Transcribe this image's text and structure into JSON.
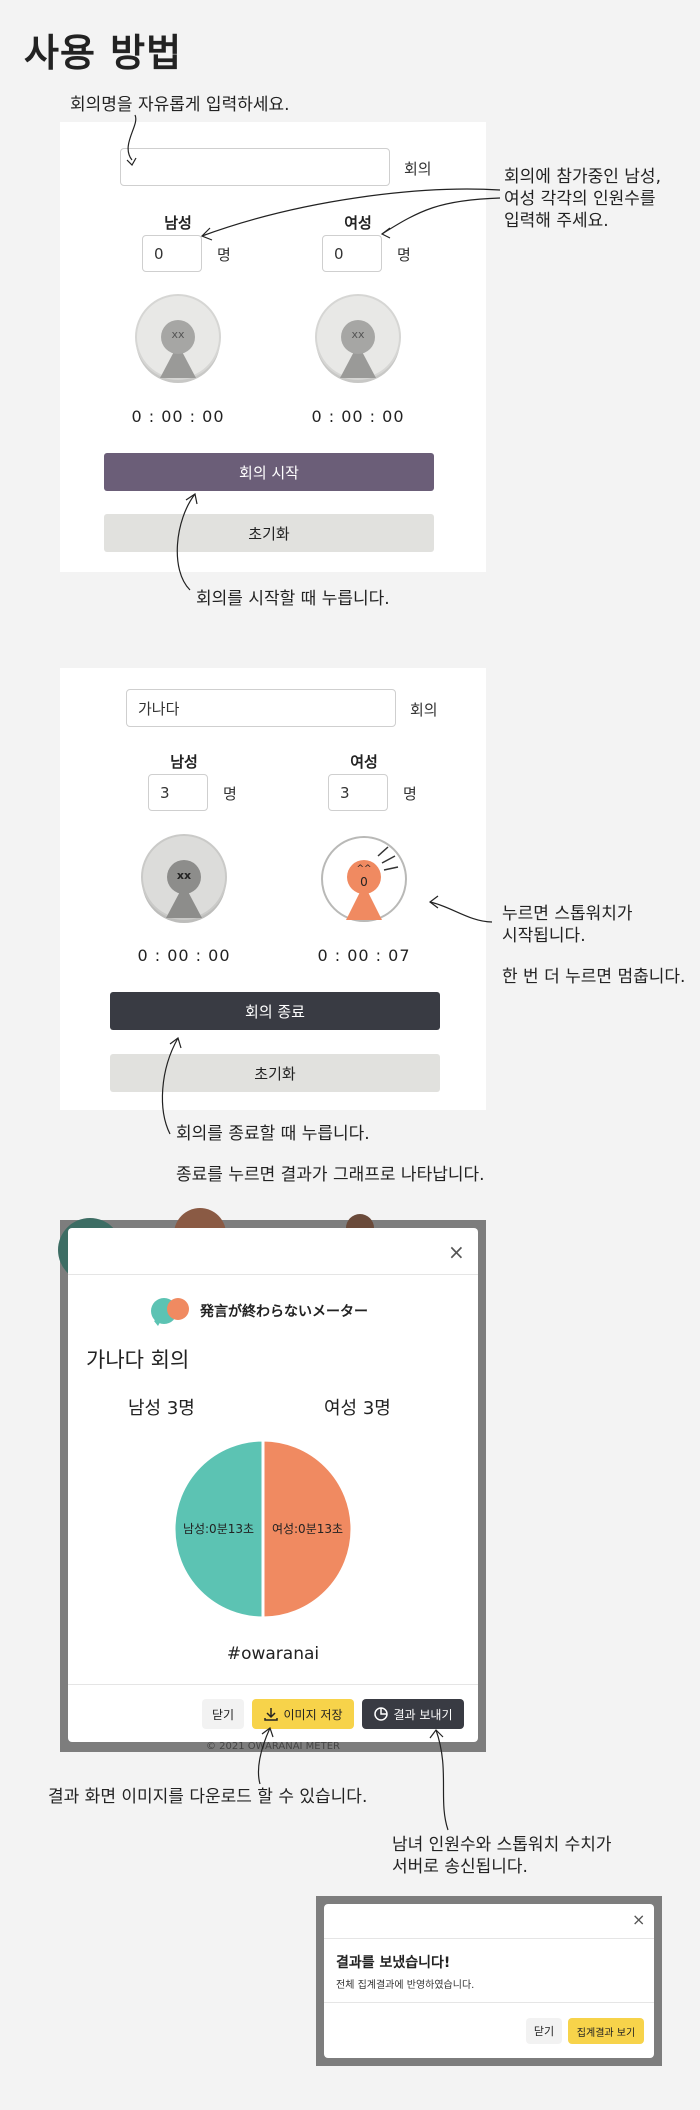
{
  "page": {
    "title": "사용 방법"
  },
  "notes": {
    "name_input": "회의명을 자유롭게 입력하세요.",
    "gender_counts": [
      "회의에 참가중인 남성,",
      "여성 각각의 인원수를",
      "입력해 주세요."
    ],
    "start": "회의를 시작할 때 누릅니다.",
    "stopwatch": [
      "누르면 스톱워치가",
      "시작됩니다."
    ],
    "stop_again": "한 번 더 누르면 멈춥니다.",
    "end": "회의를 종료할 때 누릅니다.",
    "graph": "종료를 누르면 결과가 그래프로 나타납니다.",
    "download": "결과 화면 이미지를 다운로드 할 수 있습니다.",
    "send": [
      "남녀 인원수와 스톱워치 수치가",
      "서버로 송신됩니다."
    ]
  },
  "panel1": {
    "meeting_name_value": "",
    "meeting_suffix": "회의",
    "male_label": "남성",
    "female_label": "여성",
    "male_count": "0",
    "female_count": "0",
    "unit": "명",
    "male_face": "xx",
    "female_face": "xx",
    "male_timer": "0 : 00 : 00",
    "female_timer": "0 : 00 : 00",
    "start_button": "회의 시작",
    "reset_button": "초기화"
  },
  "panel2": {
    "meeting_name_value": "가나다",
    "meeting_suffix": "회의",
    "male_label": "남성",
    "female_label": "여성",
    "male_count": "3",
    "female_count": "3",
    "unit": "명",
    "male_face": "xx",
    "female_face": "^^",
    "female_talk_count": "0",
    "male_timer": "0 : 00 : 00",
    "female_timer": "0 : 00 : 07",
    "end_button": "회의 종료",
    "reset_button": "초기화"
  },
  "result_modal": {
    "close_symbol": "×",
    "logo_text": "発言が終わらないメーター",
    "meeting_title": "가나다 회의",
    "male_summary": "남성 3명",
    "female_summary": "여성 3명",
    "hashtag": "#owaranai",
    "close_button": "닫기",
    "save_image_button": "이미지 저장",
    "send_result_button": "결과 보내기",
    "copyright": "© 2021 OWARANAI METER",
    "colors": {
      "male": "#5cc3b3",
      "female": "#f08a61",
      "save": "#f7d34a",
      "send": "#393b43"
    }
  },
  "chart_data": {
    "type": "pie",
    "categories": [
      "남성",
      "여성"
    ],
    "values": [
      13,
      13
    ],
    "slice_labels": [
      "남성:0분13초",
      "여성:0분13초"
    ],
    "colors": [
      "#5cc3b3",
      "#f08a61"
    ]
  },
  "sent_modal": {
    "close_symbol": "×",
    "heading": "결과를 보냈습니다!",
    "message": "전체 집계결과에 반영하였습니다.",
    "close_button": "닫기",
    "view_button": "집계결과 보기"
  }
}
